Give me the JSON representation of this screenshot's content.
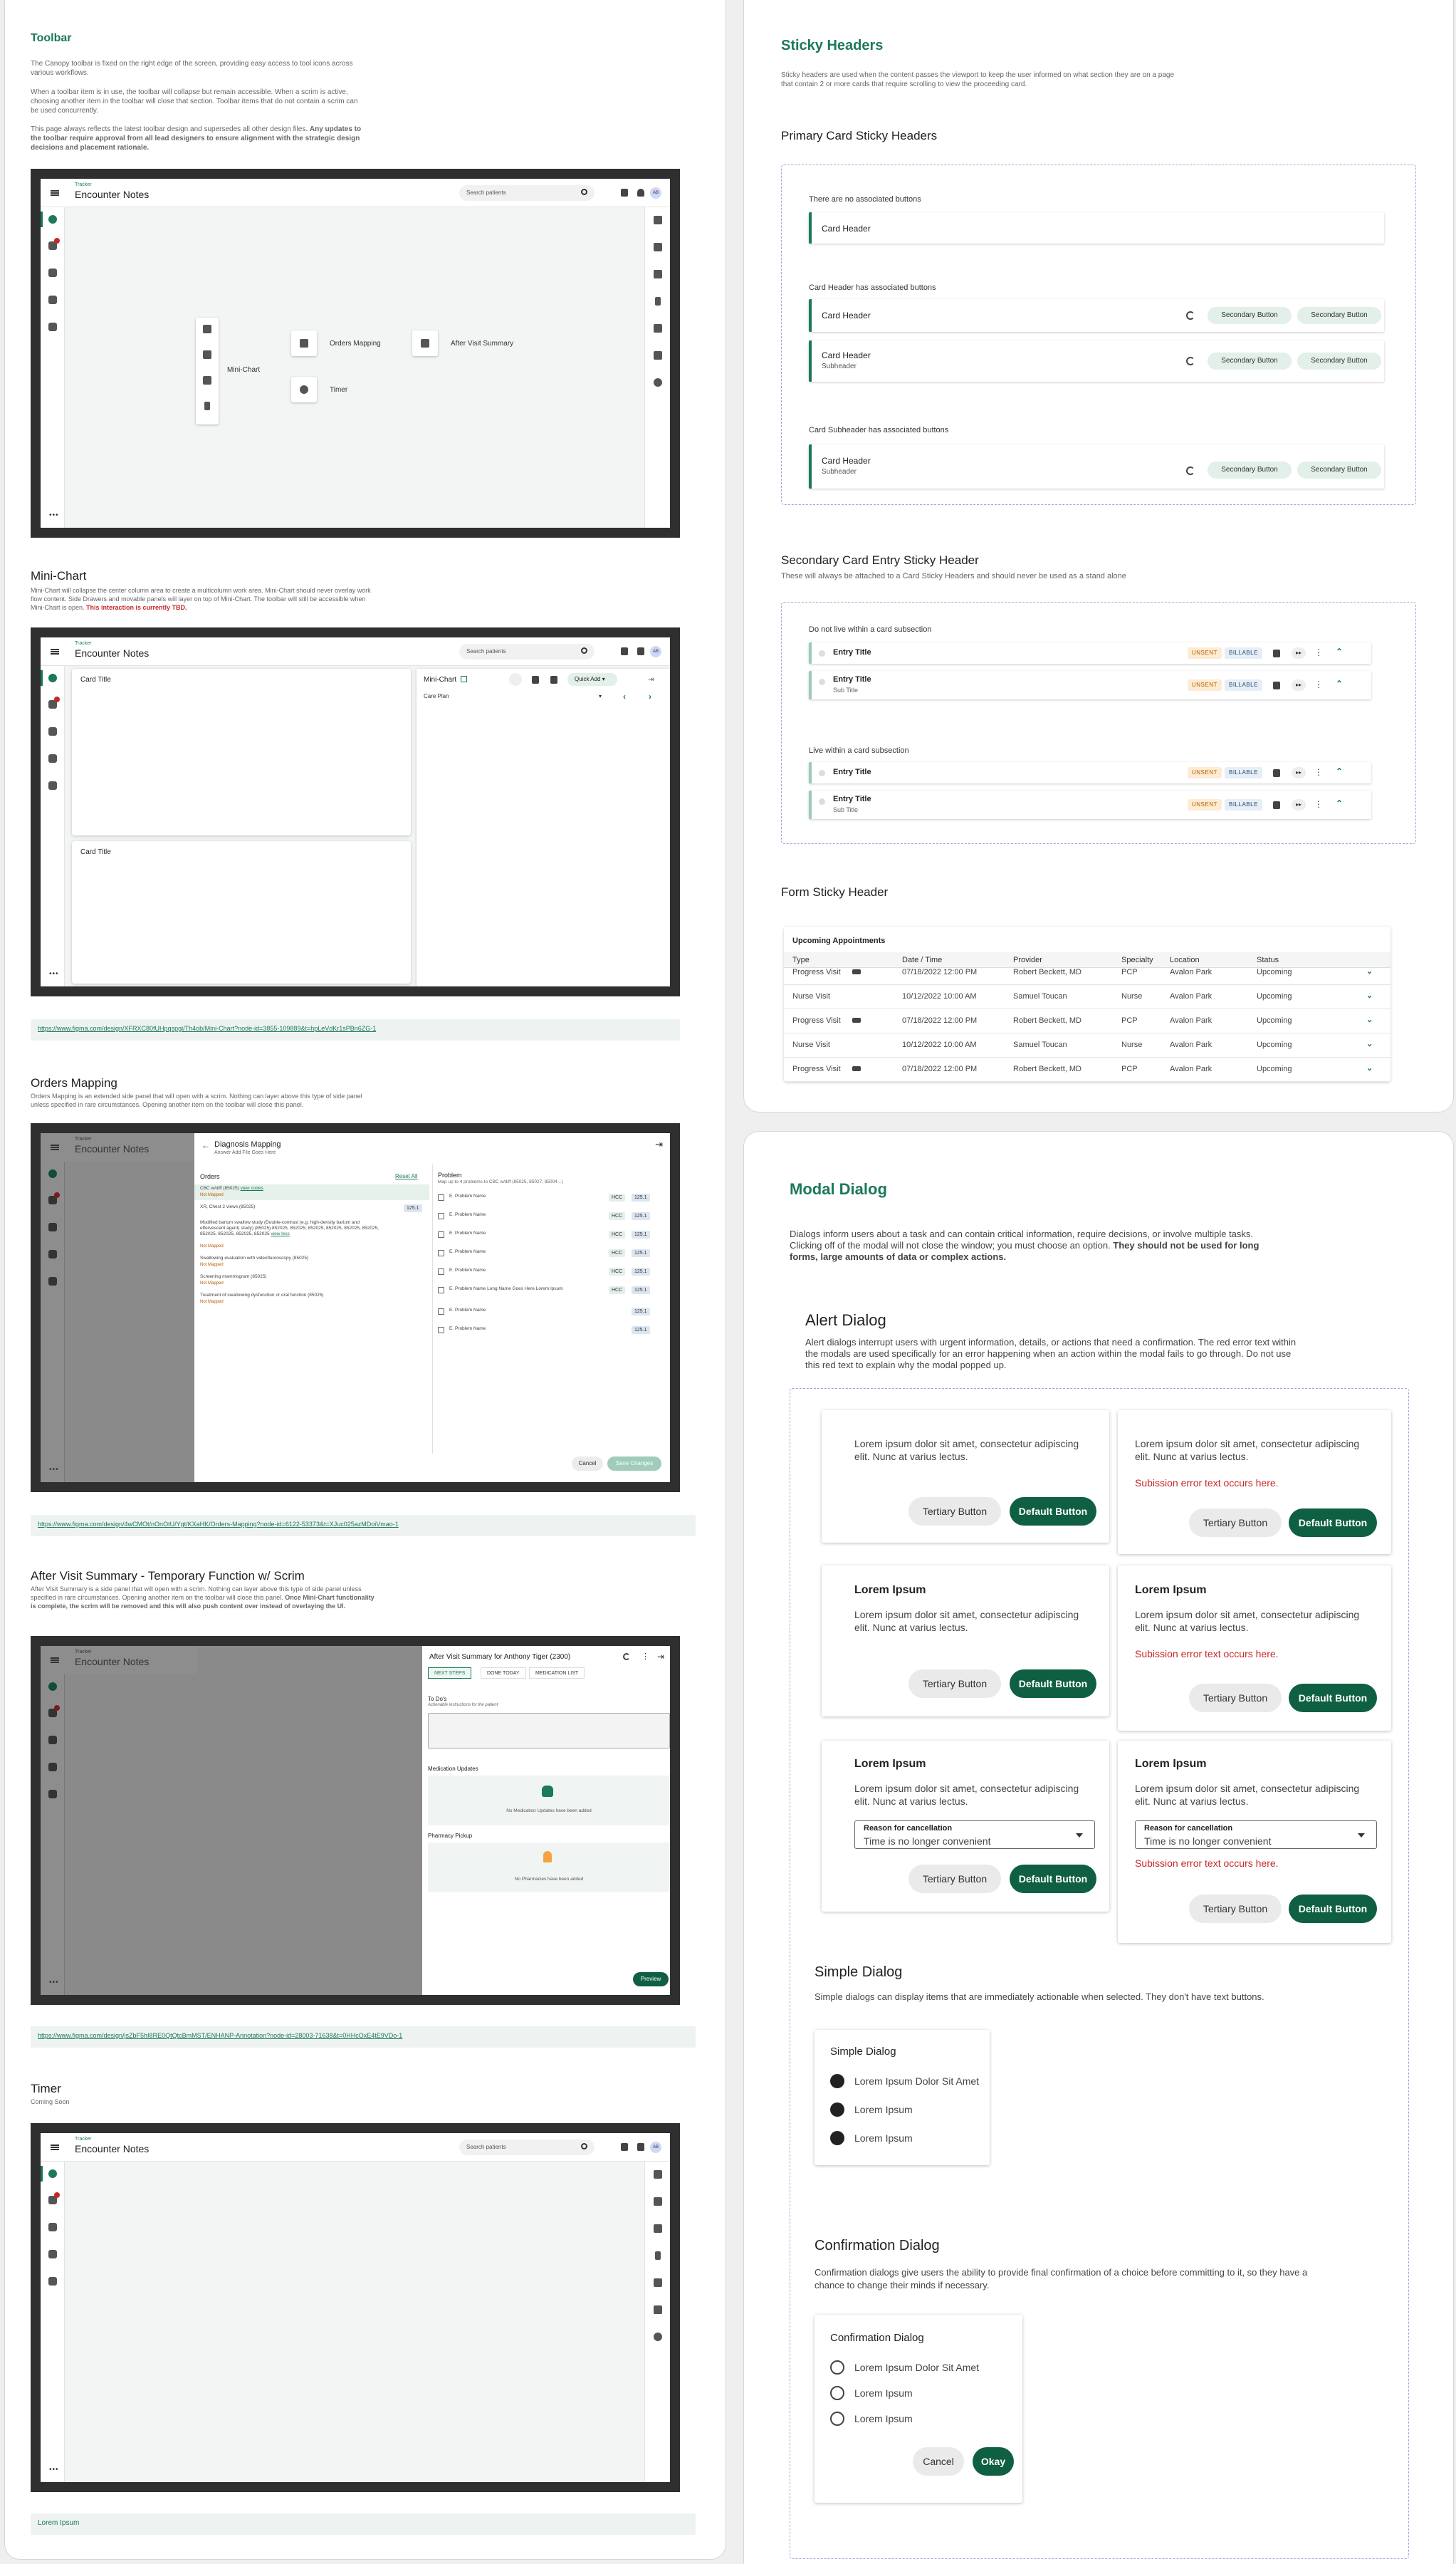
{
  "toolbar": {
    "title": "Toolbar",
    "p1": "The Canopy toolbar is fixed on the right edge of the screen, providing easy access to tool icons across various workflows.",
    "p2": "When a toolbar item is in use, the toolbar will collapse but remain accessible. When a scrim is active, choosing another item in the toolbar will close that section. Toolbar items that do not contain a scrim can be used concurrently.",
    "p3a": "This page always reflects the latest toolbar design and supersedes all other design files. ",
    "p3b": "Any updates to the toolbar require approval from all lead designers to ensure alignment with the strategic design decisions and placement rationale.",
    "mini_chart": "Mini-Chart",
    "orders_mapping": "Orders Mapping",
    "after_visit": "After Visit Summary",
    "timer": "Timer"
  },
  "app": {
    "tracker": "Tracker",
    "title": "Encounter Notes",
    "search_placeholder": "Search patients",
    "avatar": "AB",
    "more": "•••"
  },
  "mini": {
    "heading": "Mini-Chart",
    "desc": "Mini-Chart will collapse the center column area to create a multicolumn work area. Mini-Chart should never overlay work flow content. Side Drawers and movable panels will layer on top of Mini-Chart. The toolbar will still be accessible when Mini-Chart is open. ",
    "desc_red": "This interaction is currently TBD.",
    "card_title": "Card Title",
    "panel_title": "Mini-Chart",
    "quick_add": "Quick Add",
    "care_plan": "Care Plan",
    "link": "https://www.figma.com/design/XFRXC80fUHpqspgi/Th4ob/Mini-Chart?node-id=3855-109889&t=hpLeVdKr1sPBn6ZG-1"
  },
  "orders": {
    "heading": "Orders Mapping",
    "desc": "Orders Mapping is an extended side panel that will open with a scrim. Nothing can layer above this type of side panel unless specified in rare circumstances. Opening another item on the toolbar will close this panel.",
    "panel_title": "Diagnosis Mapping",
    "panel_sub": "Answer Add File Goes Here",
    "orders_label": "Orders",
    "reset": "Reset All",
    "problem_label": "Problem",
    "problem_sub": "Map up to 4 problems to CBC w/diff (85025, 85027, 85004...)",
    "items": [
      {
        "name": "CBC w/diff (85025) ",
        "link": "view codes",
        "status": "Not Mapped"
      },
      {
        "name": "XR, Chest 2 views (85025)",
        "badge": "125.1"
      },
      {
        "name": "Modified barium swallow study (Double-contrast (e.g. high-density barium and effervescent agent) study) (85025) 852025, 852025, 852025, 852025, 852025, 852025, 852025, 852025, 852025, 852025 ",
        "link": "view less",
        "status": "Not Mapped"
      },
      {
        "name": "Swallowing evaluation with videofluoroscopy (85025)",
        "status": "Not Mapped"
      },
      {
        "name": "Screening mammogram (85025)",
        "status": "Not Mapped"
      },
      {
        "name": "Treatment of swallowing dysfunction or oral function (85025)",
        "status": "Not Mapped"
      }
    ],
    "problems": [
      {
        "name": "E. Problem Name",
        "tag": "HCC",
        "code": "125.1"
      },
      {
        "name": "E. Problem Name",
        "tag": "HCC",
        "code": "125.1"
      },
      {
        "name": "E. Problem Name",
        "tag": "HCC",
        "code": "125.1"
      },
      {
        "name": "E. Problem Name",
        "tag": "HCC",
        "code": "125.1"
      },
      {
        "name": "E. Problem Name",
        "tag": "HCC",
        "code": "125.1"
      },
      {
        "name": "E. Problem Name Long Name Goes Here Lorem Ipsum",
        "tag": "HCC",
        "code": "125.1"
      },
      {
        "name": "E. Problem Name",
        "tag": "",
        "code": "125.1"
      },
      {
        "name": "E. Problem Name",
        "tag": "",
        "code": "125.1"
      }
    ],
    "cancel": "Cancel",
    "save": "Save Changes",
    "link": "https://www.figma.com/design/4wCMOt/nOnOtU/Ygt/KXaHK/Orders-Mapping?node-id=6122-53373&t=XJuc025azMDoiVmao-1"
  },
  "avs": {
    "heading": "After Visit Summary - Temporary Function w/ Scrim",
    "desc": "After Visit Summary is a side panel that will open with a scrim. Nothing can layer above this type of side panel unless specified in rare circumstances. Opening another item on the toolbar will close this panel. ",
    "desc_bold": "Once Mini-Chart functionality is complete, the scrim will be removed and this will also push content over instead of overlaying the UI.",
    "panel_title": "After Visit Summary for Anthony Tiger (2300)",
    "tabs": [
      "NEXT STEPS",
      "DONE TODAY",
      "MEDICATION LIST"
    ],
    "todo": "To Do's",
    "todo_sub": "Actionable instructions for the patient",
    "med_updates": "Medication Updates",
    "med_empty": "No Medication Updates have been added",
    "pharmacy": "Pharmacy Pickup",
    "pharm_empty": "No Pharmacies have been added",
    "preview": "Preview",
    "link": "https://www.figma.com/design/jsZbF5hI8RE0QtQtcBmMST/ENHANP-Annotation?node-id=28003-71638&t=0HHcOxE4tE9VDo-1"
  },
  "timer": {
    "heading": "Timer",
    "sub": "Coming Soon",
    "footer": "Lorem Ipsum"
  },
  "sticky": {
    "title": "Sticky Headers",
    "desc": "Sticky headers are used when the content passes the viewport to keep the user informed on what section they are on a page that contain 2 or more cards that require scrolling to view the proceeding card.",
    "primary": "Primary Card Sticky Headers",
    "none_label": "There are no associated buttons",
    "has_label": "Card Header has associated buttons",
    "sub_label": "Card Subheader has associated buttons",
    "card_header": "Card Header",
    "subheader": "Subheader",
    "secondary_btn": "Secondary Button",
    "secondary_title": "Secondary Card Entry Sticky Header",
    "secondary_desc": "These will always be attached to a Card Sticky Headers and should never be used as a stand alone",
    "not_live": "Do not live within a card subsection",
    "live": "Live within a card subsection",
    "entry_title": "Entry Title",
    "sub_title": "Sub Title",
    "unsent": "UNSENT",
    "billable": "BILLABLE",
    "form_title": "Form Sticky Header",
    "upcoming": "Upcoming Appointments"
  },
  "table": {
    "headers": [
      "Type",
      "Date / Time",
      "Provider",
      "Specialty",
      "Location",
      "Status"
    ],
    "rows": [
      [
        "Progress Visit",
        "07/18/2022  12:00 PM",
        "Robert Beckett, MD",
        "PCP",
        "Avalon Park",
        "Upcoming"
      ],
      [
        "Nurse Visit",
        "10/12/2022  10:00 AM",
        "Samuel Toucan",
        "Nurse",
        "Avalon Park",
        "Upcoming"
      ],
      [
        "Progress Visit",
        "07/18/2022  12:00 PM",
        "Robert Beckett, MD",
        "PCP",
        "Avalon Park",
        "Upcoming"
      ],
      [
        "Nurse Visit",
        "10/12/2022  10:00 AM",
        "Samuel Toucan",
        "Nurse",
        "Avalon Park",
        "Upcoming"
      ],
      [
        "Progress Visit",
        "07/18/2022  12:00 PM",
        "Robert Beckett, MD",
        "PCP",
        "Avalon Park",
        "Upcoming"
      ]
    ]
  },
  "modal": {
    "title": "Modal Dialog",
    "desc_a": "Dialogs inform users about a task and can contain critical information, require decisions, or involve multiple tasks. Clicking off of the modal will not close the window; you must choose an option. ",
    "desc_b": "They should not be used for long forms, large amounts of data or complex actions.",
    "alert_title": "Alert Dialog",
    "alert_desc": "Alert dialogs interrupt users with urgent information, details, or actions that need a confirmation. The red error text within the modals are used specifically for an error happening when an action within the modal fails to go through. Do not use this red text to explain why the modal popped up.",
    "lorem": "Lorem ipsum dolor sit amet, consectetur adipiscing elit. Nunc at varius lectus.",
    "error": "Subission error text occurs here.",
    "lorem_title": "Lorem Ipsum",
    "tertiary": "Tertiary Button",
    "default": "Default Button",
    "reason": "Reason for cancellation",
    "reason_val": "Time is no longer convenient",
    "simple_title": "Simple Dialog",
    "simple_desc": "Simple dialogs can display items that are immediately actionable when selected. They don't have text buttons.",
    "simple_head": "Simple Dialog",
    "simple_items": [
      "Lorem Ipsum Dolor Sit Amet",
      "Lorem Ipsum",
      "Lorem Ipsum"
    ],
    "confirm_title": "Confirmation Dialog",
    "confirm_desc": "Confirmation dialogs give users the ability to provide final confirmation of a choice before committing to it, so they have a chance to change their minds if necessary.",
    "confirm_head": "Confirmation Dialog",
    "confirm_items": [
      "Lorem Ipsum Dolor Sit Amet",
      "Lorem Ipsum",
      "Lorem Ipsum"
    ],
    "cancel": "Cancel",
    "okay": "Okay"
  }
}
